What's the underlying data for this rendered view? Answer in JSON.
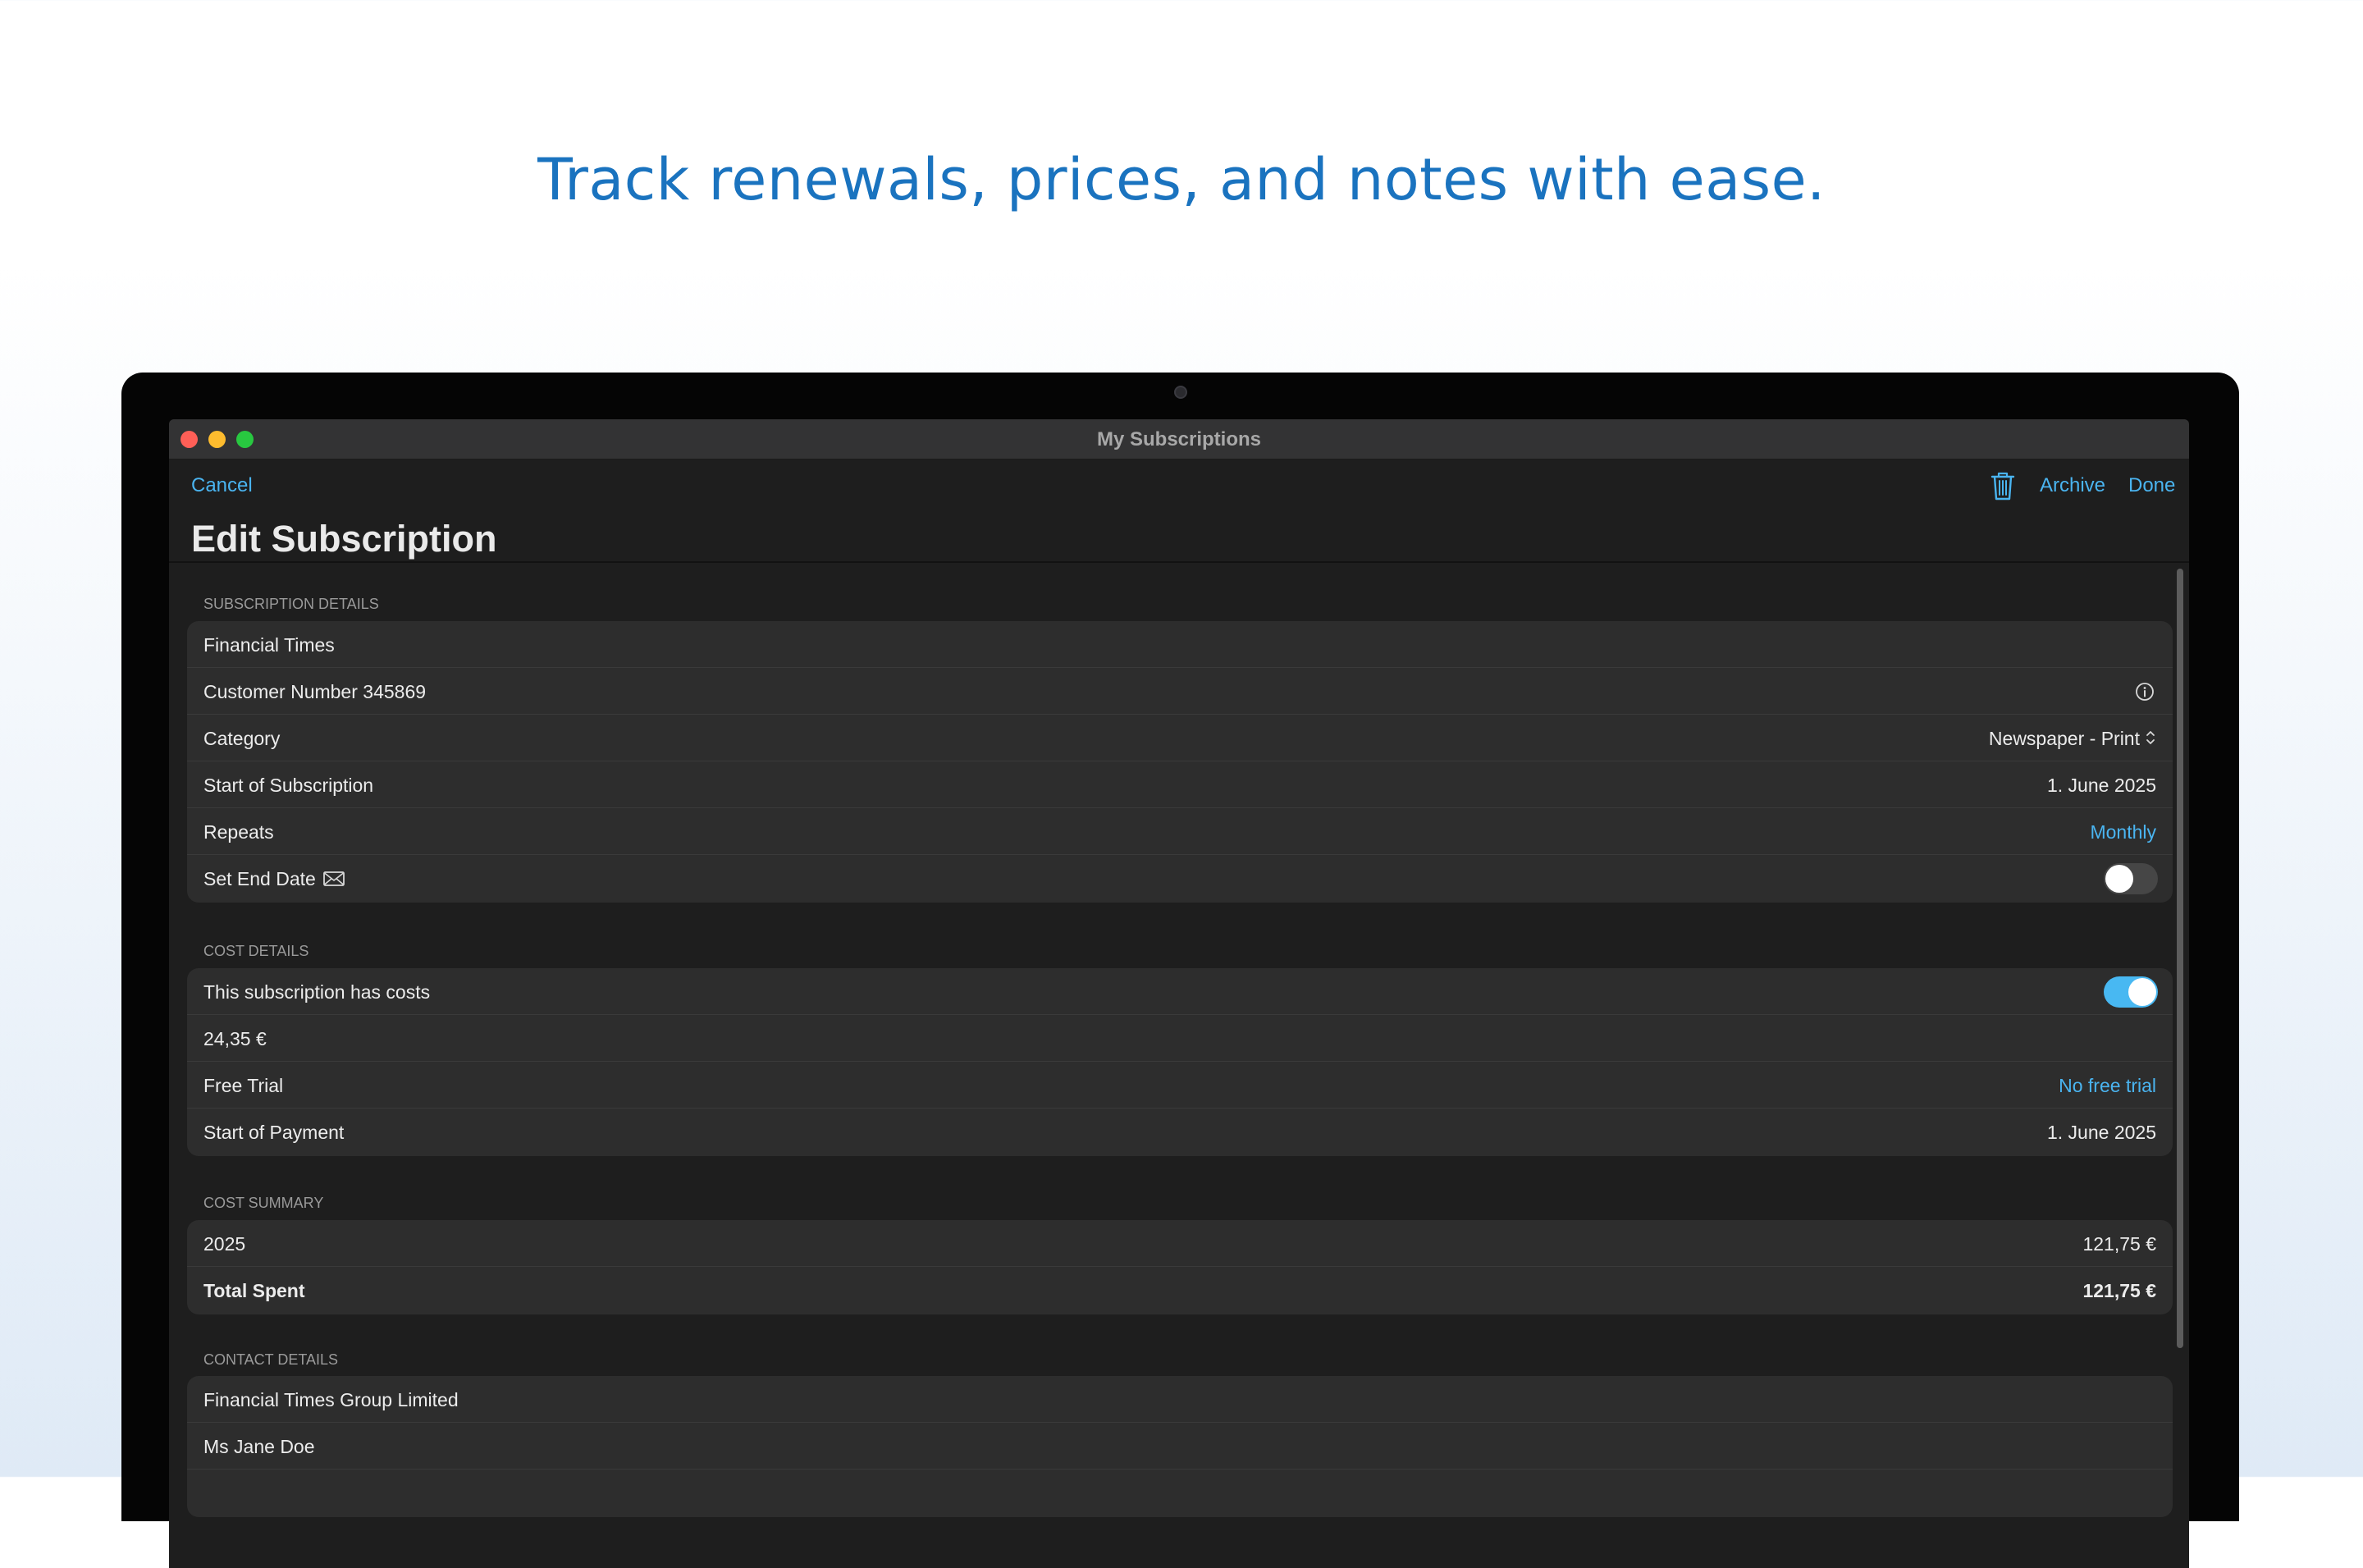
{
  "headline": "Track renewals, prices, and notes with ease.",
  "window": {
    "title": "My Subscriptions"
  },
  "toolbar": {
    "cancel_label": "Cancel",
    "archive_label": "Archive",
    "done_label": "Done",
    "trash_icon": "trash-icon"
  },
  "page_title": "Edit Subscription",
  "subscription_details": {
    "header": "SUBSCRIPTION DETAILS",
    "name": "Financial Times",
    "customer_number": "Customer Number 345869",
    "category_label": "Category",
    "category_value": "Newspaper - Print",
    "start_label": "Start of Subscription",
    "start_value": "1. June 2025",
    "repeats_label": "Repeats",
    "repeats_value": "Monthly",
    "end_date_label": "Set End Date",
    "end_date_enabled": false
  },
  "cost_details": {
    "header": "COST DETAILS",
    "has_costs_label": "This subscription has costs",
    "has_costs_enabled": true,
    "price": "24,35 €",
    "free_trial_label": "Free Trial",
    "free_trial_value": "No free trial",
    "payment_start_label": "Start of Payment",
    "payment_start_value": "1. June 2025"
  },
  "cost_summary": {
    "header": "COST SUMMARY",
    "year_label": "2025",
    "year_value": "121,75 €",
    "total_label": "Total Spent",
    "total_value": "121,75 €"
  },
  "contact_details": {
    "header": "CONTACT DETAILS",
    "company": "Financial Times Group Limited",
    "person": "Ms Jane Doe"
  },
  "colors": {
    "accent": "#4ab4f0",
    "headline": "#1a73bf",
    "toggle_on": "#48b8f2"
  }
}
